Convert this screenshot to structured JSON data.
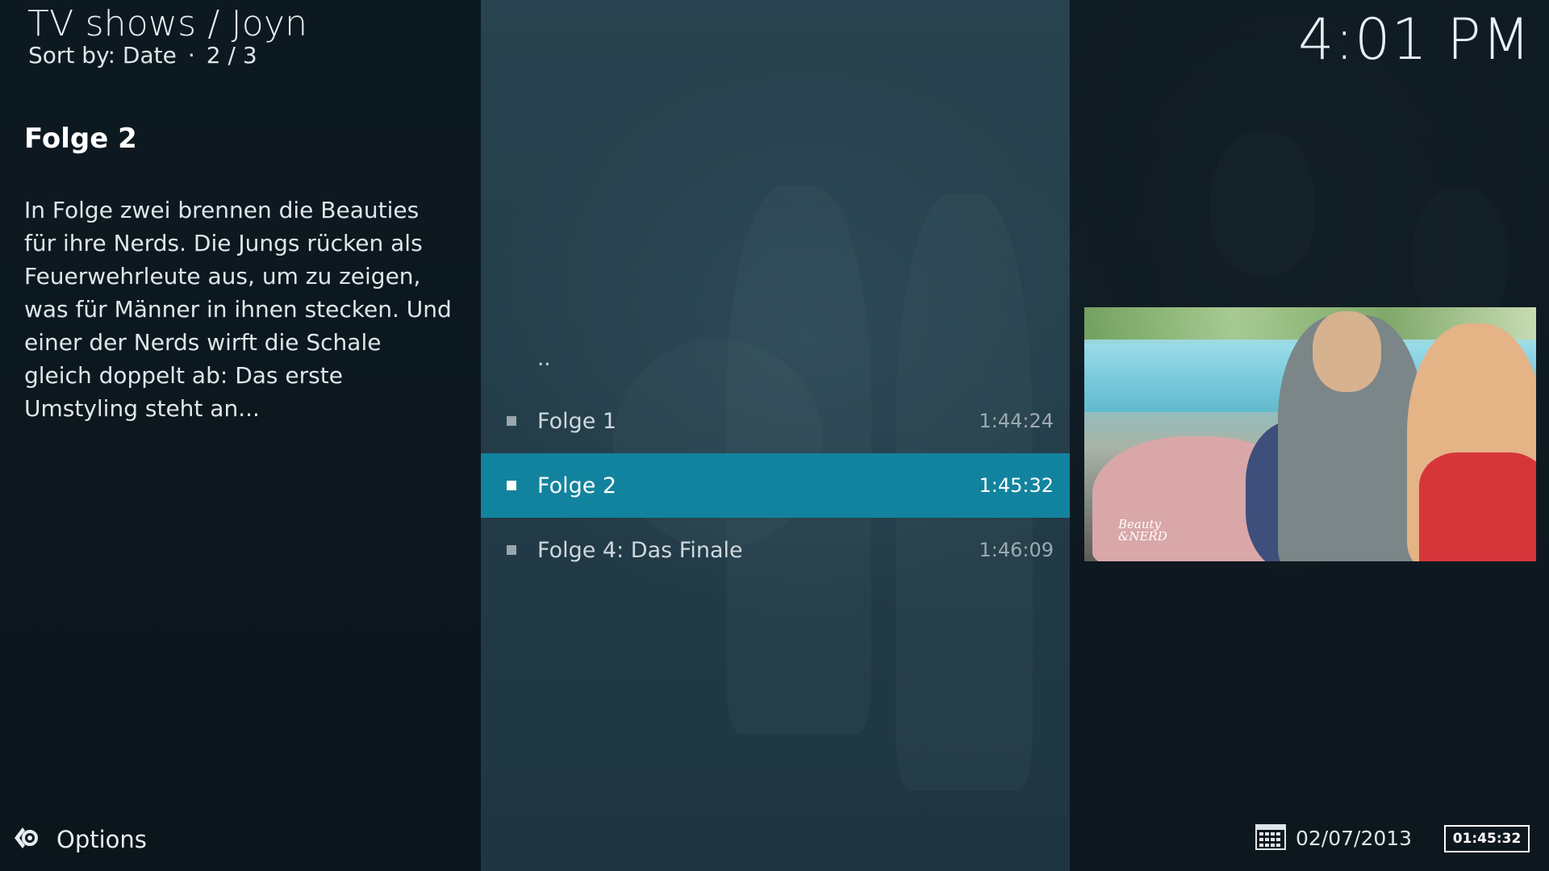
{
  "header": {
    "title": "TV shows / Joyn",
    "sort_label": "Sort by: Date",
    "position": "2 / 3",
    "clock": "4:01 PM"
  },
  "info": {
    "episode_title": "Folge 2",
    "plot": "In Folge zwei brennen die Beauties für ihre Nerds. Die Jungs rücken als Feuerwehrleute aus, um zu zeigen, was für Männer in ihnen stecken. Und einer der Nerds wirft die Schale gleich doppelt ab: Das erste Umstyling steht an..."
  },
  "list": {
    "parent_label": "..",
    "items": [
      {
        "label": "Folge 1",
        "duration": "1:44:24"
      },
      {
        "label": "Folge 2",
        "duration": "1:45:32",
        "selected": true
      },
      {
        "label": "Folge 4: Das Finale",
        "duration": "1:46:09"
      }
    ]
  },
  "thumbnail": {
    "logo_text_line1": "Beauty",
    "logo_text_line2": "&NERD"
  },
  "footer": {
    "options_label": "Options",
    "date": "02/07/2013",
    "duration_box": "01:45:32"
  },
  "colors": {
    "accent": "#12839e"
  }
}
